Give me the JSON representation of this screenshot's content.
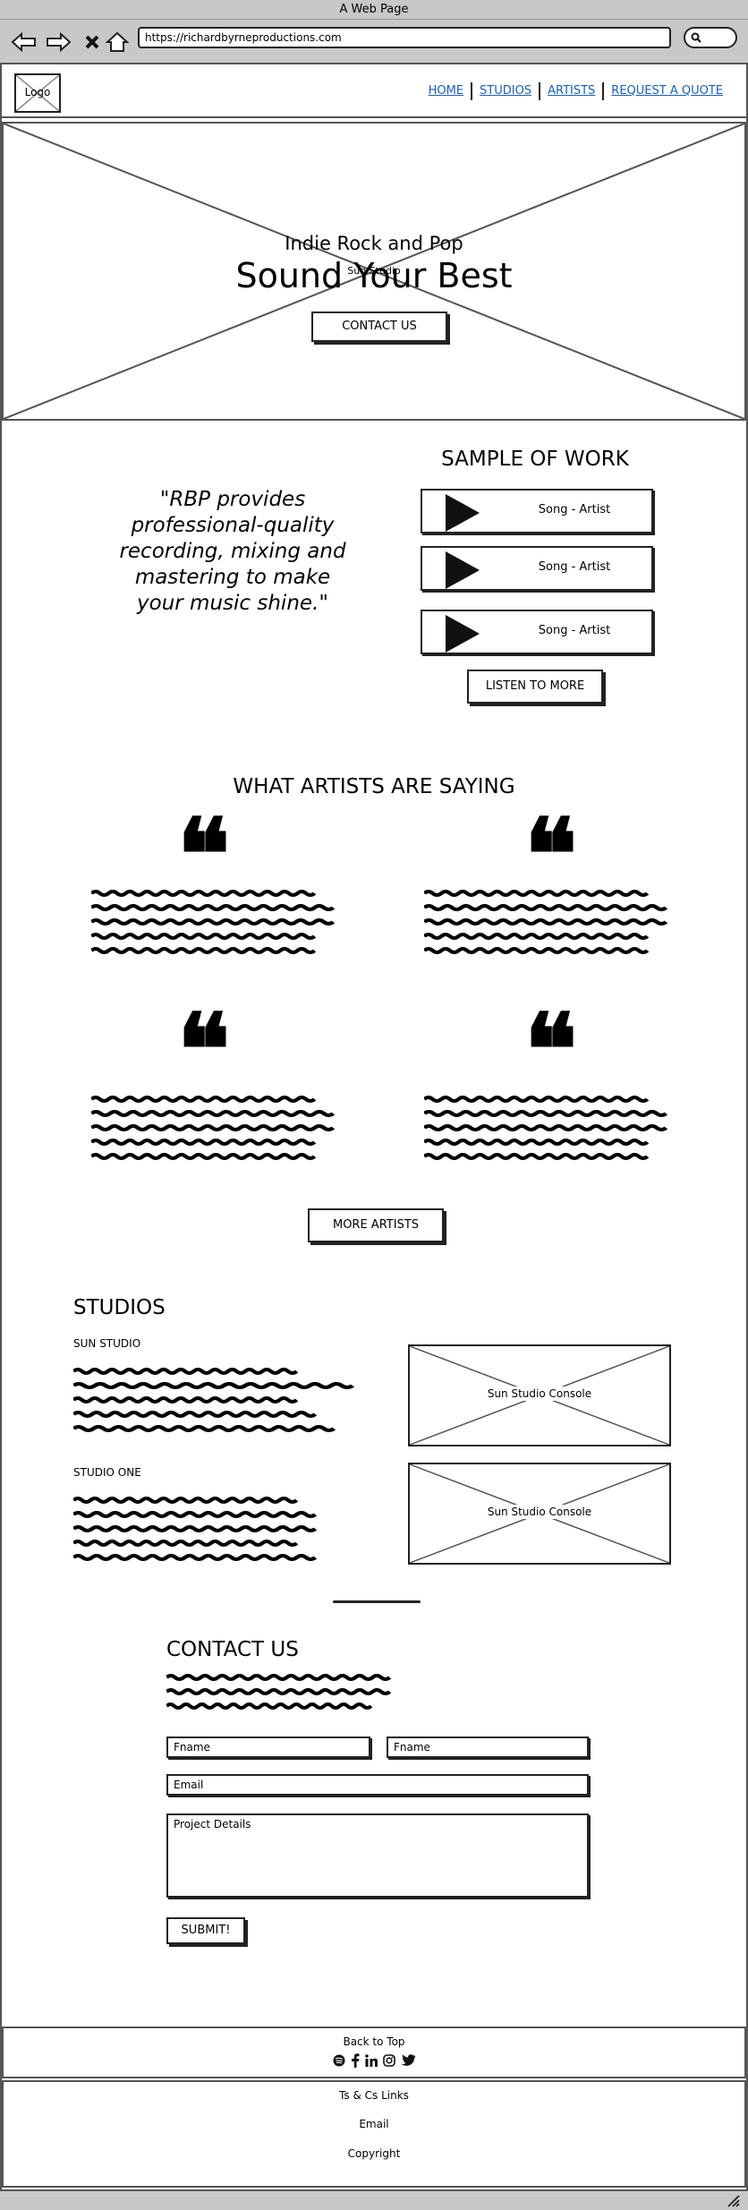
{
  "browser": {
    "title": "A Web Page",
    "url": "https://richardbyrneproductions.com",
    "icons": [
      "back-arrow-icon",
      "forward-arrow-icon",
      "close-icon",
      "home-icon",
      "search-icon"
    ]
  },
  "header": {
    "logo": "Logo",
    "nav": [
      "HOME",
      "STUDIOS",
      "ARTISTS",
      "REQUEST A QUOTE"
    ]
  },
  "hero": {
    "subtitle": "Indie Rock and Pop",
    "tagline": "Sun Studio",
    "title": "Sound Your Best",
    "button": "CONTACT US"
  },
  "intro": {
    "quote": "\"RBP provides professional-quality recording, mixing and mastering to make your music shine.\""
  },
  "samples": {
    "title": "SAMPLE OF WORK",
    "songs": [
      "Song - Artist",
      "Song - Artist",
      "Song - Artist"
    ],
    "button": "LISTEN TO MORE"
  },
  "testimonials": {
    "title": "WHAT ARTISTS ARE SAYING",
    "button": "MORE ARTISTS"
  },
  "studios": {
    "title": "STUDIOS",
    "items": [
      {
        "name": "SUN STUDIO",
        "image_label": "Sun Studio Console"
      },
      {
        "name": "STUDIO ONE",
        "image_label": "Sun Studio Console"
      }
    ]
  },
  "contact": {
    "title": "CONTACT US",
    "fname1": "Fname",
    "fname2": "Fname",
    "email": "Email",
    "details": "Project Details",
    "submit": "SUBMIT!"
  },
  "footer": {
    "back_to_top": "Back to Top",
    "social_icons": [
      "spotify-icon",
      "facebook-icon",
      "linkedin-icon",
      "instagram-icon",
      "twitter-icon"
    ],
    "links": "Ts & Cs Links",
    "email": "Email",
    "copyright": "Copyright"
  }
}
